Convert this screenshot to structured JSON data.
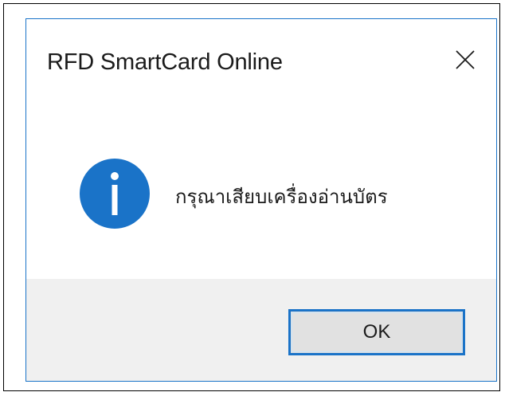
{
  "dialog": {
    "title": "RFD SmartCard Online",
    "close_icon": "close-icon",
    "icon": "info-icon",
    "message": "กรุณาเสียบเครื่องอ่านบัตร",
    "ok_label": "OK"
  },
  "colors": {
    "accent": "#1a73c8",
    "footer_bg": "#f0f0f0",
    "button_bg": "#e1e1e1",
    "text": "#1b1b1b"
  }
}
